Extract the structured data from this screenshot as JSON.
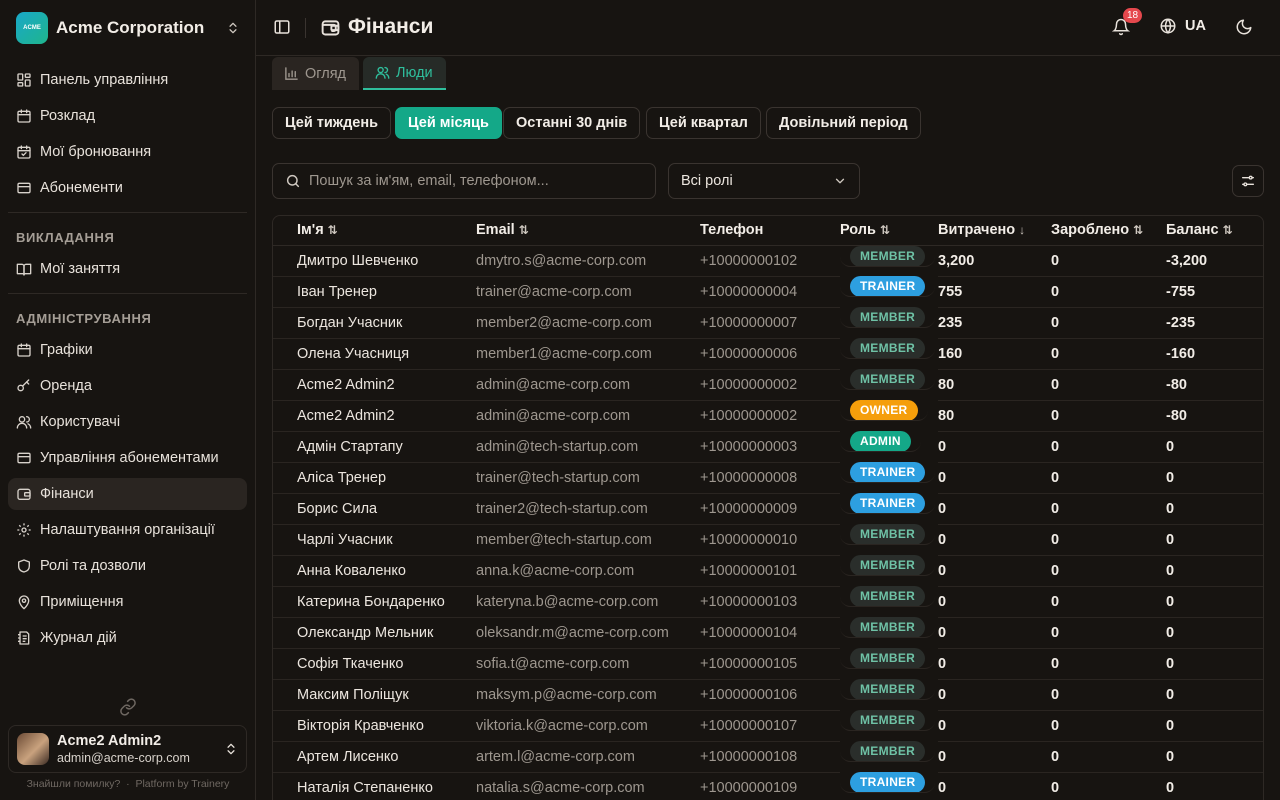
{
  "org": {
    "name": "Acme Corporation",
    "logo_text": "ACME"
  },
  "sidebar": {
    "items_top": [
      {
        "label": "Панель управління",
        "icon": "dashboard-icon"
      },
      {
        "label": "Розклад",
        "icon": "calendar-icon"
      },
      {
        "label": "Мої бронювання",
        "icon": "calendar-check-icon"
      },
      {
        "label": "Абонементи",
        "icon": "ticket-icon"
      }
    ],
    "section_teaching": "ВИКЛАДАННЯ",
    "items_teaching": [
      {
        "label": "Мої заняття",
        "icon": "book-icon"
      }
    ],
    "section_admin": "АДМІНІСТРУВАННЯ",
    "items_admin": [
      {
        "label": "Графіки",
        "icon": "calendar-icon"
      },
      {
        "label": "Оренда",
        "icon": "key-icon"
      },
      {
        "label": "Користувачі",
        "icon": "users-icon"
      },
      {
        "label": "Управління абонементами",
        "icon": "ticket-icon"
      },
      {
        "label": "Фінанси",
        "icon": "wallet-icon",
        "active": true
      },
      {
        "label": "Налаштування організації",
        "icon": "gear-icon"
      },
      {
        "label": "Ролі та дозволи",
        "icon": "shield-icon"
      },
      {
        "label": "Приміщення",
        "icon": "map-pin-icon"
      },
      {
        "label": "Журнал дій",
        "icon": "log-icon"
      }
    ]
  },
  "user": {
    "name": "Acme2 Admin2",
    "email": "admin@acme-corp.com"
  },
  "footer": {
    "report": "Знайшли помилку?",
    "sep": "·",
    "platform": "Platform by Trainery"
  },
  "header": {
    "title": "Фінанси",
    "notifications": "18",
    "lang": "UA"
  },
  "tabs": [
    {
      "label": "Огляд",
      "icon": "bar-chart-icon",
      "active": false
    },
    {
      "label": "Люди",
      "icon": "users-icon",
      "active": true
    }
  ],
  "periods": [
    {
      "label": "Цей тиждень",
      "active": false
    },
    {
      "label": "Цей місяць",
      "active": true
    },
    {
      "label": "Останні 30 днів",
      "active": false
    },
    {
      "label": "Цей квартал",
      "active": false
    },
    {
      "label": "Довільний період",
      "active": false
    }
  ],
  "search": {
    "placeholder": "Пошук за ім'ям, email, телефоном..."
  },
  "role_filter": {
    "selected": "Всі ролі"
  },
  "table": {
    "columns": [
      {
        "label": "Ім'я",
        "sort": "⇅"
      },
      {
        "label": "Email",
        "sort": "⇅"
      },
      {
        "label": "Телефон",
        "sort": ""
      },
      {
        "label": "Роль",
        "sort": "⇅"
      },
      {
        "label": "Витрачено",
        "sort": "↓"
      },
      {
        "label": "Зароблено",
        "sort": "⇅"
      },
      {
        "label": "Баланс",
        "sort": "⇅"
      }
    ],
    "rows": [
      [
        "Дмитро Шевченко",
        "dmytro.s@acme-corp.com",
        "+10000000102",
        "MEMBER",
        "3,200",
        "0",
        "-3,200"
      ],
      [
        "Іван Тренер",
        "trainer@acme-corp.com",
        "+10000000004",
        "TRAINER",
        "755",
        "0",
        "-755"
      ],
      [
        "Богдан Учасник",
        "member2@acme-corp.com",
        "+10000000007",
        "MEMBER",
        "235",
        "0",
        "-235"
      ],
      [
        "Олена Учасниця",
        "member1@acme-corp.com",
        "+10000000006",
        "MEMBER",
        "160",
        "0",
        "-160"
      ],
      [
        "Acme2 Admin2",
        "admin@acme-corp.com",
        "+10000000002",
        "MEMBER",
        "80",
        "0",
        "-80"
      ],
      [
        "Acme2 Admin2",
        "admin@acme-corp.com",
        "+10000000002",
        "OWNER",
        "80",
        "0",
        "-80"
      ],
      [
        "Адмін Стартапу",
        "admin@tech-startup.com",
        "+10000000003",
        "ADMIN",
        "0",
        "0",
        "0"
      ],
      [
        "Аліса Тренер",
        "trainer@tech-startup.com",
        "+10000000008",
        "TRAINER",
        "0",
        "0",
        "0"
      ],
      [
        "Борис Сила",
        "trainer2@tech-startup.com",
        "+10000000009",
        "TRAINER",
        "0",
        "0",
        "0"
      ],
      [
        "Чарлі Учасник",
        "member@tech-startup.com",
        "+10000000010",
        "MEMBER",
        "0",
        "0",
        "0"
      ],
      [
        "Анна Коваленко",
        "anna.k@acme-corp.com",
        "+10000000101",
        "MEMBER",
        "0",
        "0",
        "0"
      ],
      [
        "Катерина Бондаренко",
        "kateryna.b@acme-corp.com",
        "+10000000103",
        "MEMBER",
        "0",
        "0",
        "0"
      ],
      [
        "Олександр Мельник",
        "oleksandr.m@acme-corp.com",
        "+10000000104",
        "MEMBER",
        "0",
        "0",
        "0"
      ],
      [
        "Софія Ткаченко",
        "sofia.t@acme-corp.com",
        "+10000000105",
        "MEMBER",
        "0",
        "0",
        "0"
      ],
      [
        "Максим Поліщук",
        "maksym.p@acme-corp.com",
        "+10000000106",
        "MEMBER",
        "0",
        "0",
        "0"
      ],
      [
        "Вікторія Кравченко",
        "viktoria.k@acme-corp.com",
        "+10000000107",
        "MEMBER",
        "0",
        "0",
        "0"
      ],
      [
        "Артем Лисенко",
        "artem.l@acme-corp.com",
        "+10000000108",
        "MEMBER",
        "0",
        "0",
        "0"
      ],
      [
        "Наталія Степаненко",
        "natalia.s@acme-corp.com",
        "+10000000109",
        "TRAINER",
        "0",
        "0",
        "0"
      ]
    ]
  },
  "colors": {
    "accent": "#14a888",
    "trainer": "#2d9fe0",
    "owner": "#f59e0b",
    "badge": "#e5484d"
  }
}
